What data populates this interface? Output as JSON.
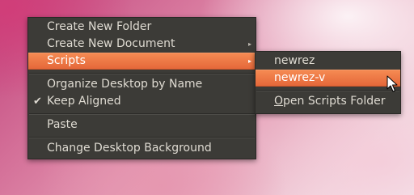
{
  "context_menu": {
    "items": [
      {
        "label": "Create New Folder"
      },
      {
        "label": "Create New Document",
        "has_submenu": true
      },
      {
        "label": "Scripts",
        "has_submenu": true,
        "highlighted": true
      },
      {
        "label": "Organize Desktop by Name"
      },
      {
        "label": "Keep Aligned",
        "checked": true
      },
      {
        "label": "Paste"
      },
      {
        "label": "Change Desktop Background"
      }
    ],
    "arrow_glyph": "▸",
    "check_glyph": "✔"
  },
  "scripts_submenu": {
    "items": [
      {
        "label": "newrez"
      },
      {
        "label": "newrez-v",
        "highlighted": true
      },
      {
        "mnemonic": "O",
        "label_rest": "pen Scripts Folder"
      }
    ]
  },
  "colors": {
    "menu_background": "#3c3b37",
    "menu_text": "#dfdbd2",
    "highlight": "#f07746",
    "highlight_text": "#ffffff"
  },
  "icons": {
    "pointer": "mouse-pointer-icon"
  }
}
